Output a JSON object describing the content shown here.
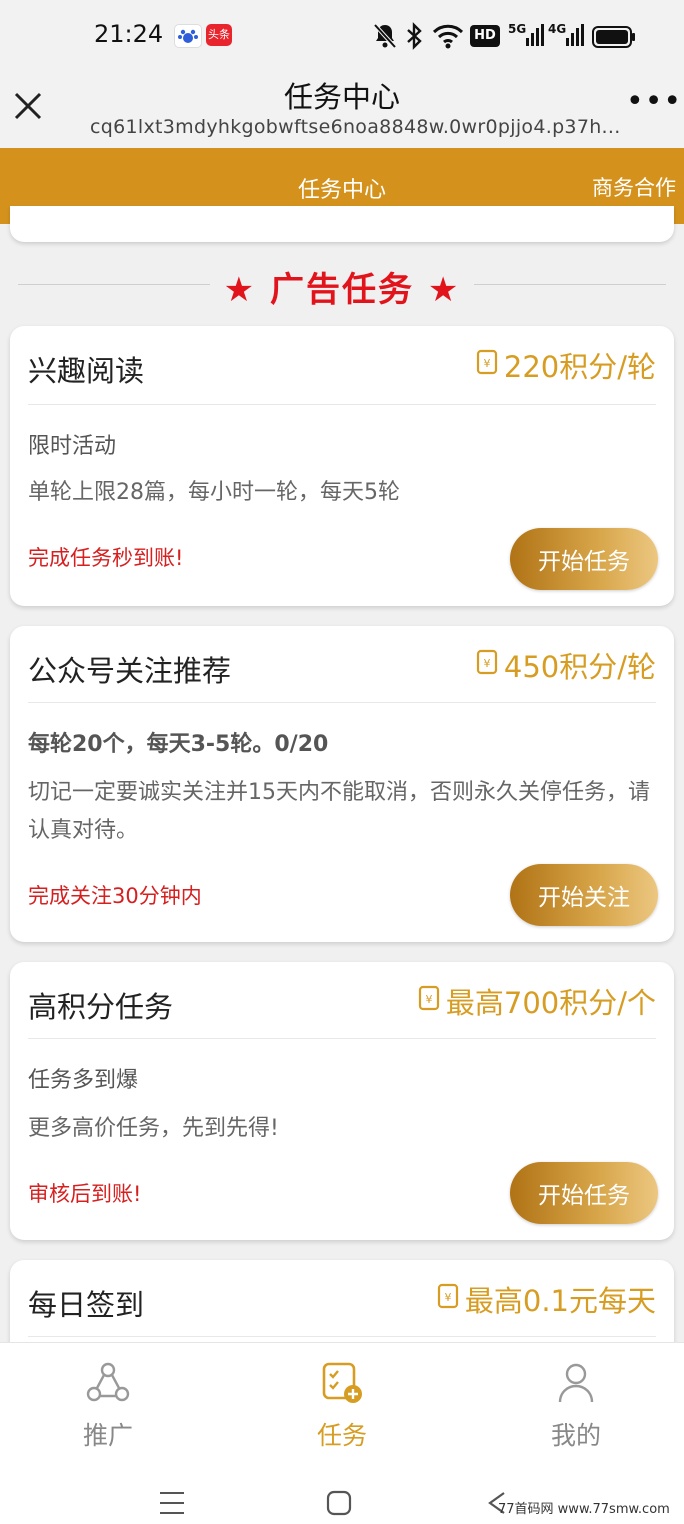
{
  "status_bar": {
    "time": "21:24",
    "app_icons": [
      "baidu-icon",
      "toutiao-icon"
    ],
    "toutiao_label": "头条",
    "network": [
      "HD",
      "5G",
      "4G"
    ]
  },
  "browser": {
    "title": "任务中心",
    "url": "cq61lxt3mdyhkgobwftse6noa8848w.0wr0pjjo4.p37h...",
    "more_label": "•••"
  },
  "nav": {
    "title": "任务中心",
    "right_link": "商务合作",
    "bg_color": "#d4921d"
  },
  "section": {
    "title": "★ 广告任务 ★",
    "color": "#e2141b"
  },
  "tasks": [
    {
      "title": "兴趣阅读",
      "reward": "220积分/轮",
      "subtitle": "限时活动",
      "description": "单轮上限28篇，每小时一轮，每天5轮",
      "note": "完成任务秒到账!",
      "button": "开始任务"
    },
    {
      "title": "公众号关注推荐",
      "reward": "450积分/轮",
      "subtitle": "每轮20个，每天3-5轮。0/20",
      "description": "切记一定要诚实关注并15天内不能取消，否则永久关停任务，请认真对待。",
      "note": "完成关注30分钟内",
      "button": "开始关注"
    },
    {
      "title": "高积分任务",
      "reward": "最高700积分/个",
      "subtitle": "任务多到爆",
      "description": "更多高价任务，先到先得!",
      "note": "审核后到账!",
      "button": "开始任务"
    },
    {
      "title": "每日签到",
      "reward": "最高0.1元每天"
    }
  ],
  "bottom_nav": [
    {
      "label": "推广",
      "icon": "promote-icon",
      "active": false
    },
    {
      "label": "任务",
      "icon": "task-icon",
      "active": true
    },
    {
      "label": "我的",
      "icon": "profile-icon",
      "active": false
    }
  ],
  "colors": {
    "accent": "#d79d23",
    "note_red": "#d62020",
    "inactive_tab": "#888888"
  },
  "watermark": "77首码网 www.77smw.com"
}
